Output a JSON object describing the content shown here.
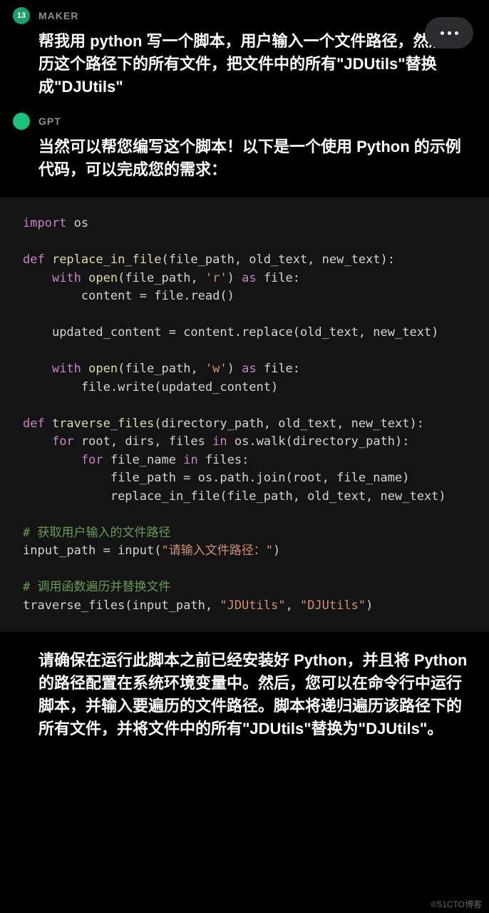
{
  "maker": {
    "label": "MAKER",
    "avatar_text": "13",
    "message": "帮我用 python 写一个脚本，用户输入一个文件路径，然后遍历这个路径下的所有文件，把文件中的所有\"JDUtils\"替换成\"DJUtils\""
  },
  "gpt": {
    "label": "GPT",
    "intro": "当然可以帮您编写这个脚本！以下是一个使用 Python 的示例代码，可以完成您的需求：",
    "outro": "请确保在运行此脚本之前已经安装好 Python，并且将 Python 的路径配置在系统环境变量中。然后，您可以在命令行中运行脚本，并输入要遍历的文件路径。脚本将递归遍历该路径下的所有文件，并将文件中的所有\"JDUtils\"替换为\"DJUtils\"。"
  },
  "code": {
    "l1_kw": "import",
    "l1_mod": " os",
    "l3_kw": "def",
    "l3_fn": " replace_in_file",
    "l3_args": "(file_path, old_text, new_text):",
    "l4_kw": "    with",
    "l4_fn": " open",
    "l4_p1": "(file_path, ",
    "l4_str": "'r'",
    "l4_p2": ") ",
    "l4_as": "as",
    "l4_p3": " file:",
    "l5": "        content = file.read()",
    "l7": "    updated_content = content.replace(old_text, new_text)",
    "l9_kw": "    with",
    "l9_fn": " open",
    "l9_p1": "(file_path, ",
    "l9_str": "'w'",
    "l9_p2": ") ",
    "l9_as": "as",
    "l9_p3": " file:",
    "l10": "        file.write(updated_content)",
    "l12_kw": "def",
    "l12_fn": " traverse_files",
    "l12_args": "(directory_path, old_text, new_text):",
    "l13_kw": "    for",
    "l13_p1": " root, dirs, files ",
    "l13_in": "in",
    "l13_p2": " os.walk(directory_path):",
    "l14_kw": "        for",
    "l14_p1": " file_name ",
    "l14_in": "in",
    "l14_p2": " files:",
    "l15": "            file_path = os.path.join(root, file_name)",
    "l16": "            replace_in_file(file_path, old_text, new_text)",
    "c1": "# 获取用户输入的文件路径",
    "l18_p1": "input_path = input(",
    "l18_str": "\"请输入文件路径：\"",
    "l18_p2": ")",
    "c2": "# 调用函数遍历并替换文件",
    "l20_p1": "traverse_files(input_path, ",
    "l20_s1": "\"JDUtils\"",
    "l20_p2": ", ",
    "l20_s2": "\"DJUtils\"",
    "l20_p3": ")"
  },
  "watermark": "©51CTO博客"
}
